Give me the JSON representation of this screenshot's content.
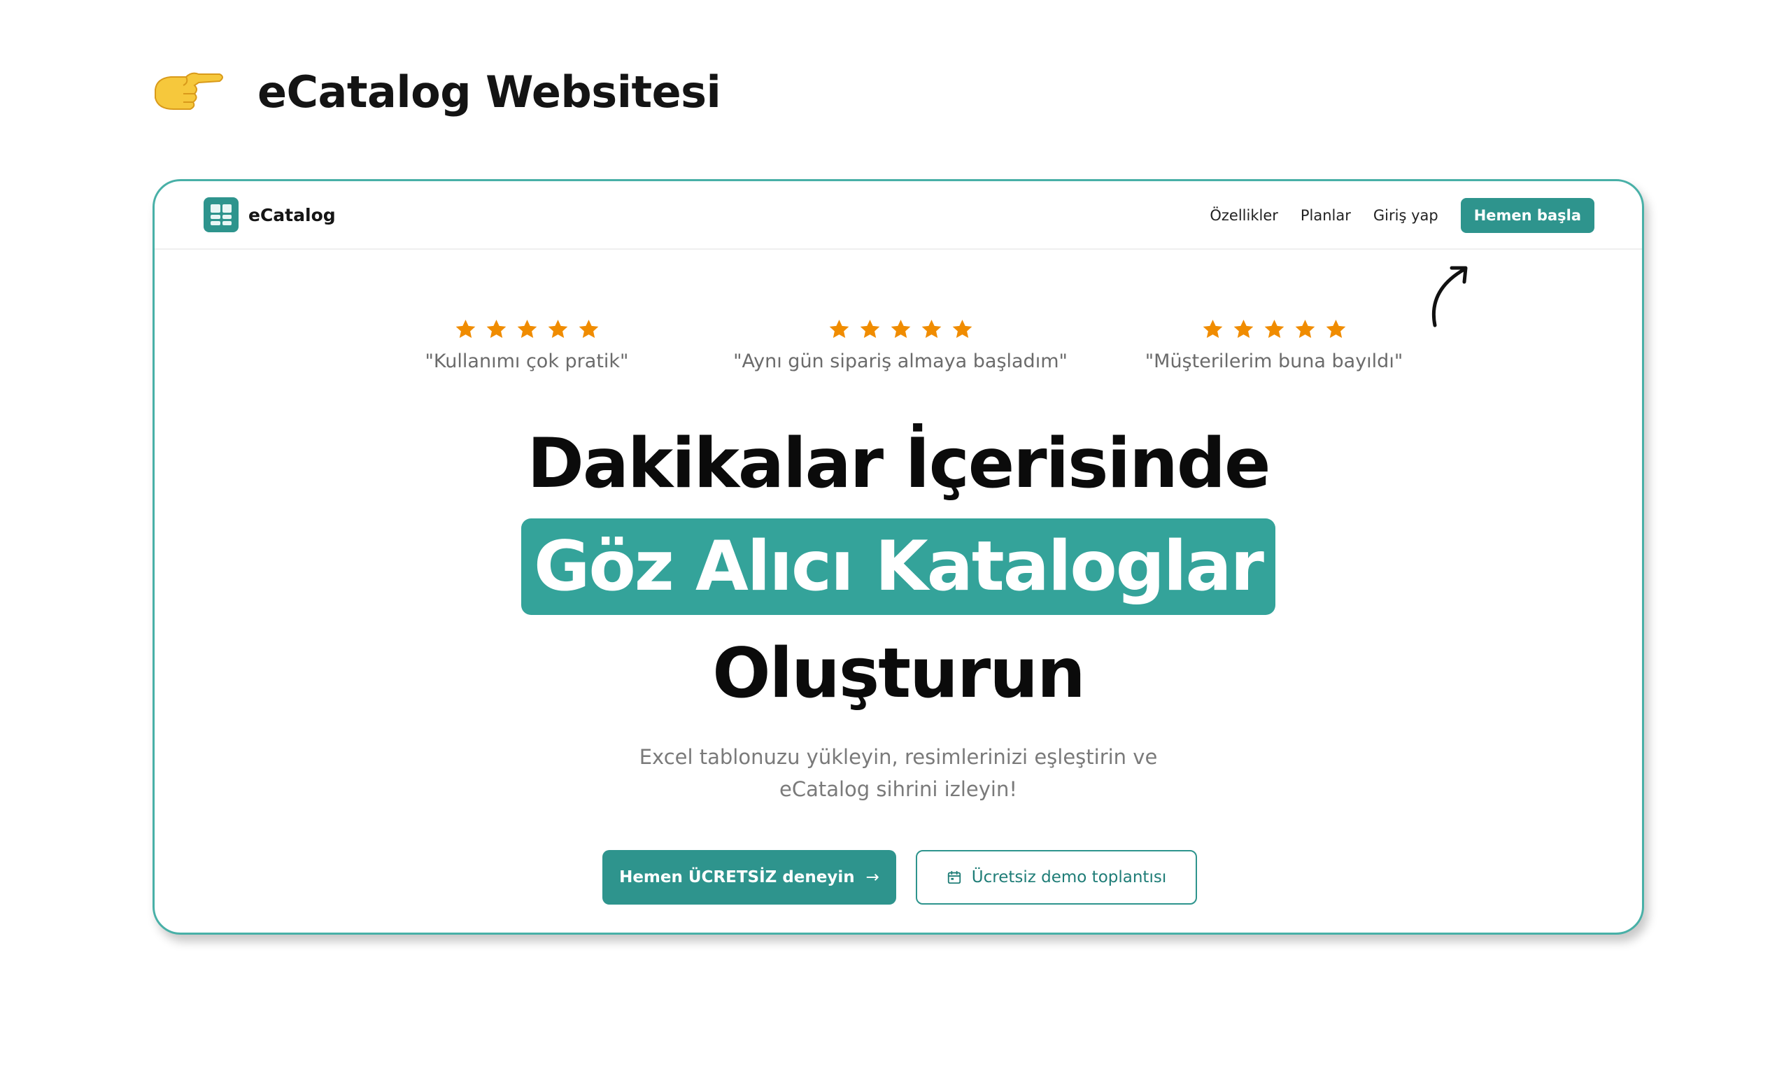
{
  "page": {
    "title": "eCatalog Websitesi",
    "icon": "pointing-hand-icon"
  },
  "navbar": {
    "brand": "eCatalog",
    "links": [
      "Özellikler",
      "Planlar",
      "Giriş yap"
    ],
    "cta": "Hemen başla"
  },
  "reviews": [
    {
      "rating": 5,
      "quote": "\"Kullanımı çok pratik\""
    },
    {
      "rating": 5,
      "quote": "\"Aynı gün sipariş almaya başladım\""
    },
    {
      "rating": 5,
      "quote": "\"Müşterilerim buna bayıldı\""
    }
  ],
  "hero": {
    "line1": "Dakikalar İçerisinde",
    "highlight": "Göz Alıcı Kataloglar",
    "line3": "Oluşturun",
    "subtitle_line1": "Excel tablonuzu yükleyin, resimlerinizi eşleştirin ve",
    "subtitle_line2": "eCatalog sihrini izleyin!"
  },
  "buttons": {
    "primary": "Hemen ÜCRETSİZ deneyin",
    "primary_icon": "arrow-right-icon",
    "secondary": "Ücretsiz demo toplantısı",
    "secondary_icon": "calendar-icon"
  },
  "colors": {
    "accent": "#2e948d",
    "highlight": "#34a39a",
    "star": "#f08c00",
    "border": "#48b0a7"
  }
}
